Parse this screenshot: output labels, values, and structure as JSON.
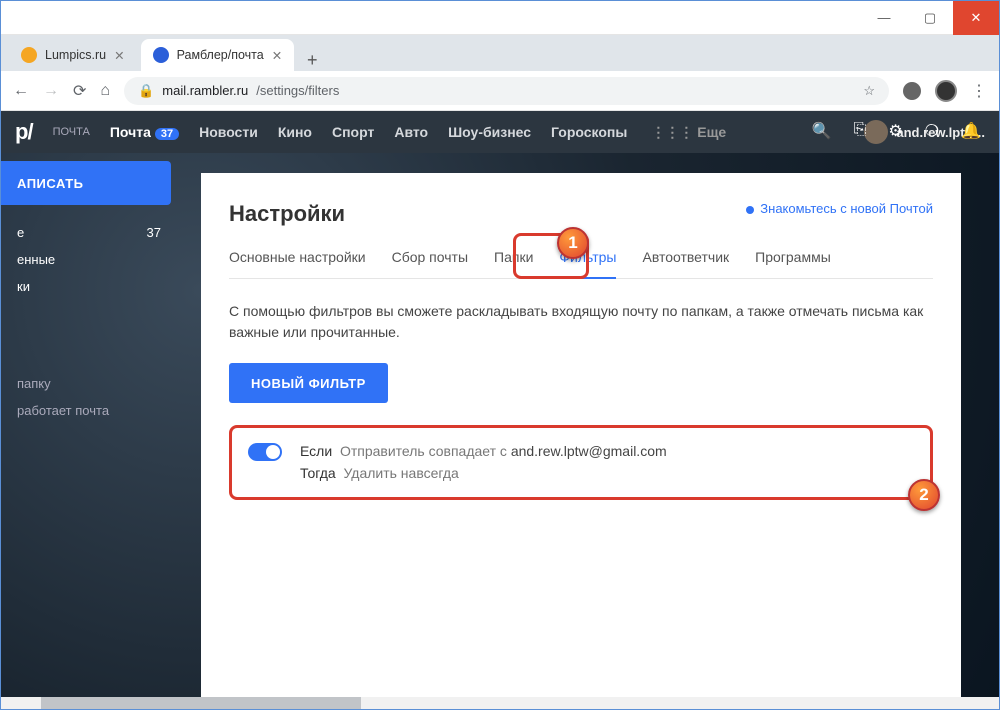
{
  "window": {
    "min": "—",
    "max": "▢",
    "close": "✕"
  },
  "tabs": [
    {
      "title": "Lumpics.ru",
      "favicon": "#f5a623"
    },
    {
      "title": "Рамблер/почта",
      "favicon": "#2b5fd9"
    }
  ],
  "newtab": "+",
  "nav": {
    "back": "←",
    "fwd": "→",
    "reload": "⟳",
    "home": "⌂",
    "lock": "🔒",
    "host": "mail.rambler.ru",
    "path": "/settings/filters",
    "star": "☆",
    "menu": "⋮"
  },
  "topnav": {
    "logo": "p/",
    "logo_sub": "ПОЧТА",
    "items": [
      "Почта",
      "Новости",
      "Кино",
      "Спорт",
      "Авто",
      "Шоу-бизнес",
      "Гороскопы"
    ],
    "badge": "37",
    "more": "Еще",
    "user": "and.rew.lptw..."
  },
  "toolbar": [
    "🔍",
    "⎘",
    "⚙",
    "❍",
    "🔔"
  ],
  "sidebar": {
    "compose": "АПИСАТЬ",
    "items": [
      {
        "l": "е",
        "r": "37"
      },
      {
        "l": "енные",
        "r": ""
      },
      {
        "l": "ки",
        "r": ""
      }
    ],
    "extra": [
      "папку",
      "работает почта"
    ]
  },
  "panel": {
    "title": "Настройки",
    "new_mail": "Знакомьтесь с новой Почтой",
    "tabs": [
      "Основные настройки",
      "Сбор почты",
      "Папки",
      "Фильтры",
      "Автоответчик",
      "Программы"
    ],
    "desc": "С помощью фильтров вы сможете раскладывать входящую почту по папкам, а также отмечать письма как важные или прочитанные.",
    "newfilter": "НОВЫЙ ФИЛЬТР",
    "filter": {
      "if": "Если",
      "if_cond": "Отправитель совпадает с",
      "if_val": "and.rew.lptw@gmail.com",
      "then": "Тогда",
      "then_act": "Удалить навсегда"
    }
  },
  "callouts": {
    "one": "1",
    "two": "2"
  }
}
